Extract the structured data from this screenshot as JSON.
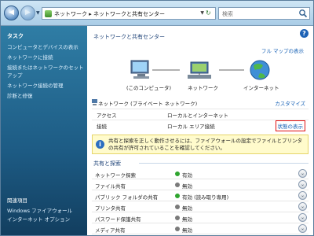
{
  "addressbar": {
    "path": "ネットワーク ▸ ネットワークと共有センター",
    "search_placeholder": "検索"
  },
  "sidebar": {
    "title": "タスク",
    "tasks": [
      "コンピュータとデバイスの表示",
      "ネットワークに接続",
      "接続またはネットワークのセットアップ",
      "ネットワーク接続の管理",
      "診断と修復"
    ],
    "related_title": "関連項目",
    "related": [
      "Windows ファイアウォール",
      "インターネット オプション"
    ]
  },
  "main": {
    "title": "ネットワークと共有センター",
    "full_map_link": "フル マップの表示",
    "help": "?",
    "diagram": {
      "computer_label": "(このコンピュータ)",
      "network_label": "ネットワーク",
      "internet_label": "インターネット"
    },
    "network": {
      "name": "ネットワーク (プライベート ネットワーク)",
      "customize_link": "カスタマイズ",
      "access_label": "アクセス",
      "access_value": "ローカルとインターネット",
      "connection_label": "接続",
      "connection_value": "ローカル エリア接続",
      "status_link": "状態の表示"
    },
    "info_text": "共有と探索を正しく動作させるには、ファイアウォールの設定でファイルとプリンタの共有が許可されていることを確認してください。",
    "sharing": {
      "title": "共有と探索",
      "rows": [
        {
          "label": "ネットワーク探索",
          "status": "有効",
          "on": true
        },
        {
          "label": "ファイル共有",
          "status": "無効",
          "on": false
        },
        {
          "label": "パブリック フォルダの共有",
          "status": "有効 (読み取り専用)",
          "on": true
        },
        {
          "label": "プリンタ共有",
          "status": "無効",
          "on": false
        },
        {
          "label": "パスワード保護共有",
          "status": "無効",
          "on": false
        },
        {
          "label": "メディア共有",
          "status": "無効",
          "on": false
        }
      ]
    }
  },
  "colors": {
    "sidebar": "#1d5b84",
    "link": "#1560b5",
    "status_on": "#2fa52f",
    "status_off": "#7a7a7a",
    "info_bg": "#fffbcc",
    "highlight_border": "#e01010"
  }
}
